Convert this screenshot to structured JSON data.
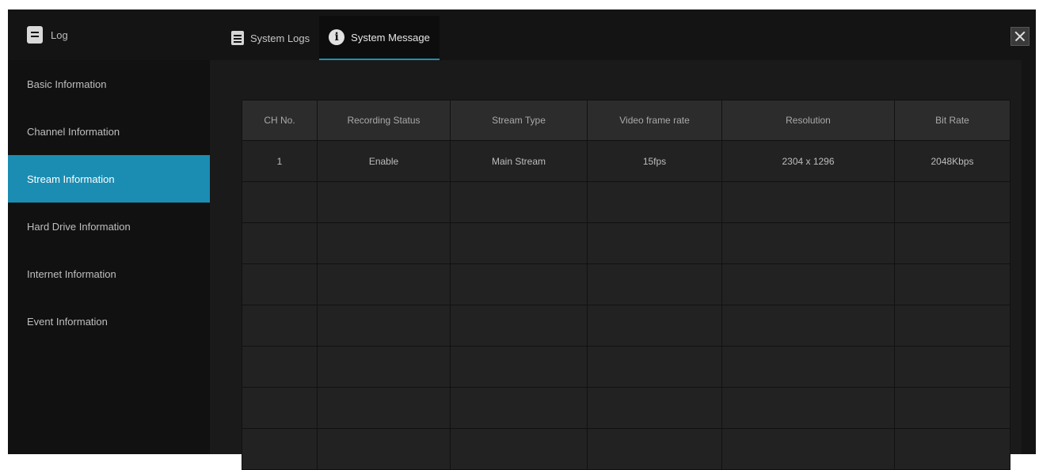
{
  "window": {
    "title": "Log"
  },
  "tabs": [
    {
      "label": "System Logs",
      "icon": "document-icon",
      "active": false
    },
    {
      "label": "System Message",
      "icon": "info-icon",
      "active": true
    }
  ],
  "sidebar": {
    "items": [
      {
        "label": "Basic Information",
        "active": false
      },
      {
        "label": "Channel Information",
        "active": false
      },
      {
        "label": "Stream Information",
        "active": true
      },
      {
        "label": "Hard Drive Information",
        "active": false
      },
      {
        "label": "Internet Information",
        "active": false
      },
      {
        "label": "Event Information",
        "active": false
      }
    ]
  },
  "table": {
    "columns": [
      "CH No.",
      "Recording Status",
      "Stream Type",
      "Video frame rate",
      "Resolution",
      "Bit Rate"
    ],
    "rows": [
      [
        "1",
        "Enable",
        "Main Stream",
        "15fps",
        "2304 x 1296",
        "2048Kbps"
      ],
      [
        "",
        "",
        "",
        "",
        "",
        ""
      ],
      [
        "",
        "",
        "",
        "",
        "",
        ""
      ],
      [
        "",
        "",
        "",
        "",
        "",
        ""
      ],
      [
        "",
        "",
        "",
        "",
        "",
        ""
      ],
      [
        "",
        "",
        "",
        "",
        "",
        ""
      ],
      [
        "",
        "",
        "",
        "",
        "",
        ""
      ],
      [
        "",
        "",
        "",
        "",
        "",
        ""
      ]
    ]
  },
  "colors": {
    "accent": "#1b8db2",
    "background": "#1b1b1b",
    "sidebar": "#111111"
  }
}
